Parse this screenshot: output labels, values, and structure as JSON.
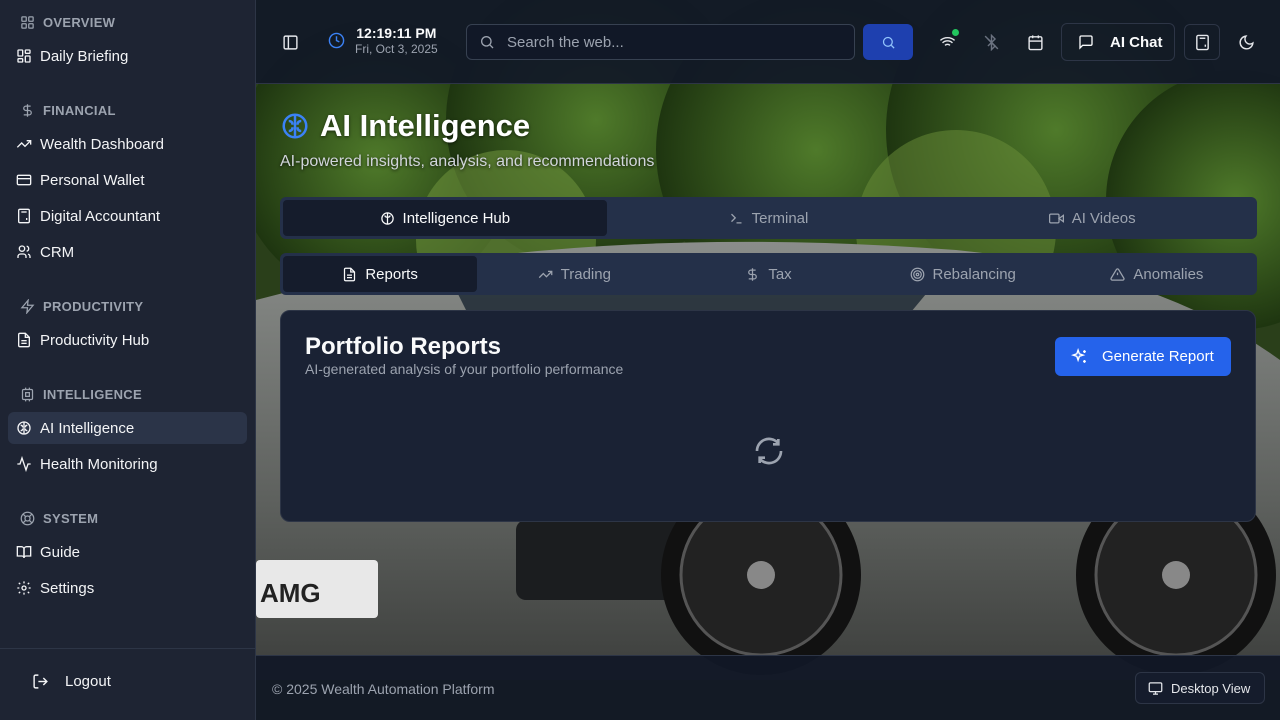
{
  "sidebar": {
    "sections": [
      {
        "label": "OVERVIEW",
        "icon": "grid-icon"
      },
      {
        "label": "FINANCIAL",
        "icon": "dollar-icon"
      },
      {
        "label": "PRODUCTIVITY",
        "icon": "lightning-icon"
      },
      {
        "label": "INTELLIGENCE",
        "icon": "cpu-icon"
      },
      {
        "label": "SYSTEM",
        "icon": "lifebuoy-icon"
      }
    ],
    "items": {
      "daily_briefing": "Daily Briefing",
      "wealth_dashboard": "Wealth Dashboard",
      "personal_wallet": "Personal Wallet",
      "digital_accountant": "Digital Accountant",
      "crm": "CRM",
      "productivity_hub": "Productivity Hub",
      "ai_intelligence": "AI Intelligence",
      "health_monitoring": "Health Monitoring",
      "guide": "Guide",
      "settings": "Settings"
    },
    "active_item": "AI Intelligence",
    "logout": "Logout"
  },
  "topbar": {
    "time": "12:19:11 PM",
    "date": "Fri, Oct 3, 2025",
    "search_placeholder": "Search the web...",
    "ai_chat": "AI Chat",
    "wifi_status_color": "#22c55e"
  },
  "page": {
    "title": "AI Intelligence",
    "subtitle": "AI-powered insights, analysis, and recommendations"
  },
  "main_tabs": {
    "intelligence_hub": "Intelligence Hub",
    "terminal": "Terminal",
    "ai_videos": "AI Videos",
    "active": "Intelligence Hub"
  },
  "sub_tabs": {
    "reports": "Reports",
    "trading": "Trading",
    "tax": "Tax",
    "rebalancing": "Rebalancing",
    "anomalies": "Anomalies",
    "active": "Reports"
  },
  "card": {
    "title": "Portfolio Reports",
    "subtitle": "AI-generated analysis of your portfolio performance",
    "generate_button": "Generate Report",
    "loading": true
  },
  "footer": {
    "copyright": "© 2025 Wealth Automation Platform",
    "desktop_view": "Desktop View"
  },
  "colors": {
    "accent": "#2563eb",
    "sidebar_bg": "#1e2433",
    "card_bg": "#1a2234"
  }
}
